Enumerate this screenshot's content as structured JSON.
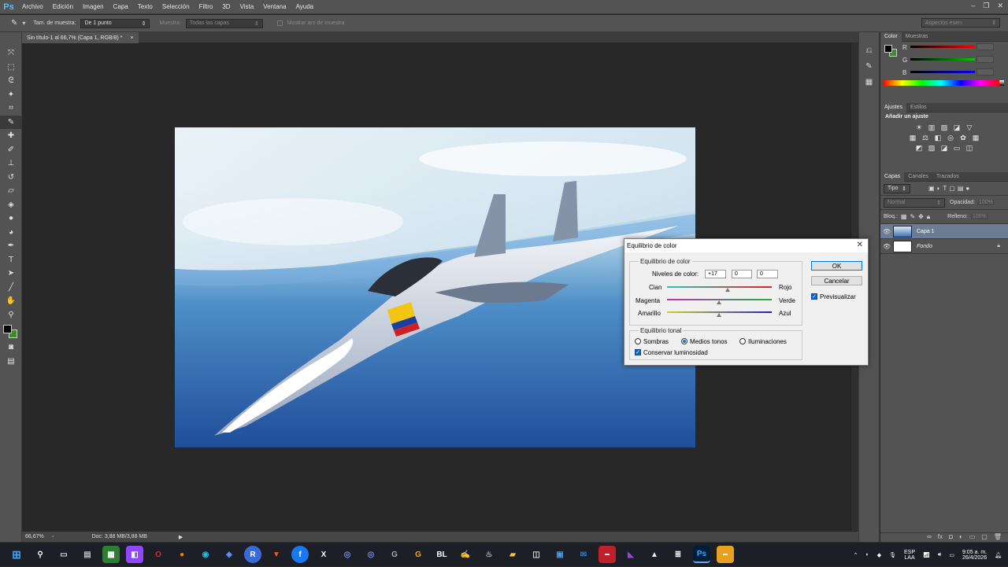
{
  "app": {
    "logo": "Ps"
  },
  "menu": [
    "Archivo",
    "Edición",
    "Imagen",
    "Capa",
    "Texto",
    "Selección",
    "Filtro",
    "3D",
    "Vista",
    "Ventana",
    "Ayuda"
  ],
  "options": {
    "sample_size_label": "Tam. de muestra:",
    "sample_size_value": "De 1 punto",
    "sample_label": "Muestra:",
    "sample_value": "Todas las capas",
    "ring_label": "Mostrar aro de muestra",
    "workspace": "Aspectos esen."
  },
  "document": {
    "tab": "Sin título-1 al 66,7% (Capa 1, RGB/8) *",
    "close": "×"
  },
  "status": {
    "zoom": "66,67%",
    "doc": "Doc: 3,88 MB/3,88 MB"
  },
  "color_panel": {
    "tabs": [
      "Color",
      "Muestras"
    ],
    "channels": [
      "R",
      "G",
      "B"
    ]
  },
  "adjust_panel": {
    "tabs": [
      "Ajustes",
      "Estilos"
    ],
    "heading": "Añadir un ajuste"
  },
  "layers_panel": {
    "tabs": [
      "Capas",
      "Canales",
      "Trazados"
    ],
    "filter": "Tipo",
    "blend": "Normal",
    "opacity_label": "Opacidad:",
    "opacity_value": "100%",
    "lock_label": "Bloq.:",
    "fill_label": "Relleno:",
    "fill_value": "100%",
    "layers": [
      {
        "name": "Capa 1",
        "selected": true
      },
      {
        "name": "Fondo",
        "selected": false,
        "locked": true
      }
    ]
  },
  "dialog": {
    "title": "Equilibrio de color",
    "group1": "Equilibrio de color",
    "levels_label": "Niveles de color:",
    "levels": [
      "+17",
      "0",
      "0"
    ],
    "sliders": [
      {
        "left": "Cian",
        "right": "Rojo",
        "value": 17
      },
      {
        "left": "Magenta",
        "right": "Verde",
        "value": 0
      },
      {
        "left": "Amarillo",
        "right": "Azul",
        "value": 0
      }
    ],
    "group2": "Equilibrio tonal",
    "tones": [
      "Sombras",
      "Medios tonos",
      "Iluminaciones"
    ],
    "selected_tone": "Medios tonos",
    "preserve": "Conservar luminosidad",
    "ok": "OK",
    "cancel": "Cancelar",
    "preview": "Previsualizar"
  },
  "taskbar": {
    "apps": [
      "BL"
    ],
    "lang": "ESP",
    "region": "LAA",
    "time": "9:05 a. m.",
    "date": "26/4/2026"
  }
}
